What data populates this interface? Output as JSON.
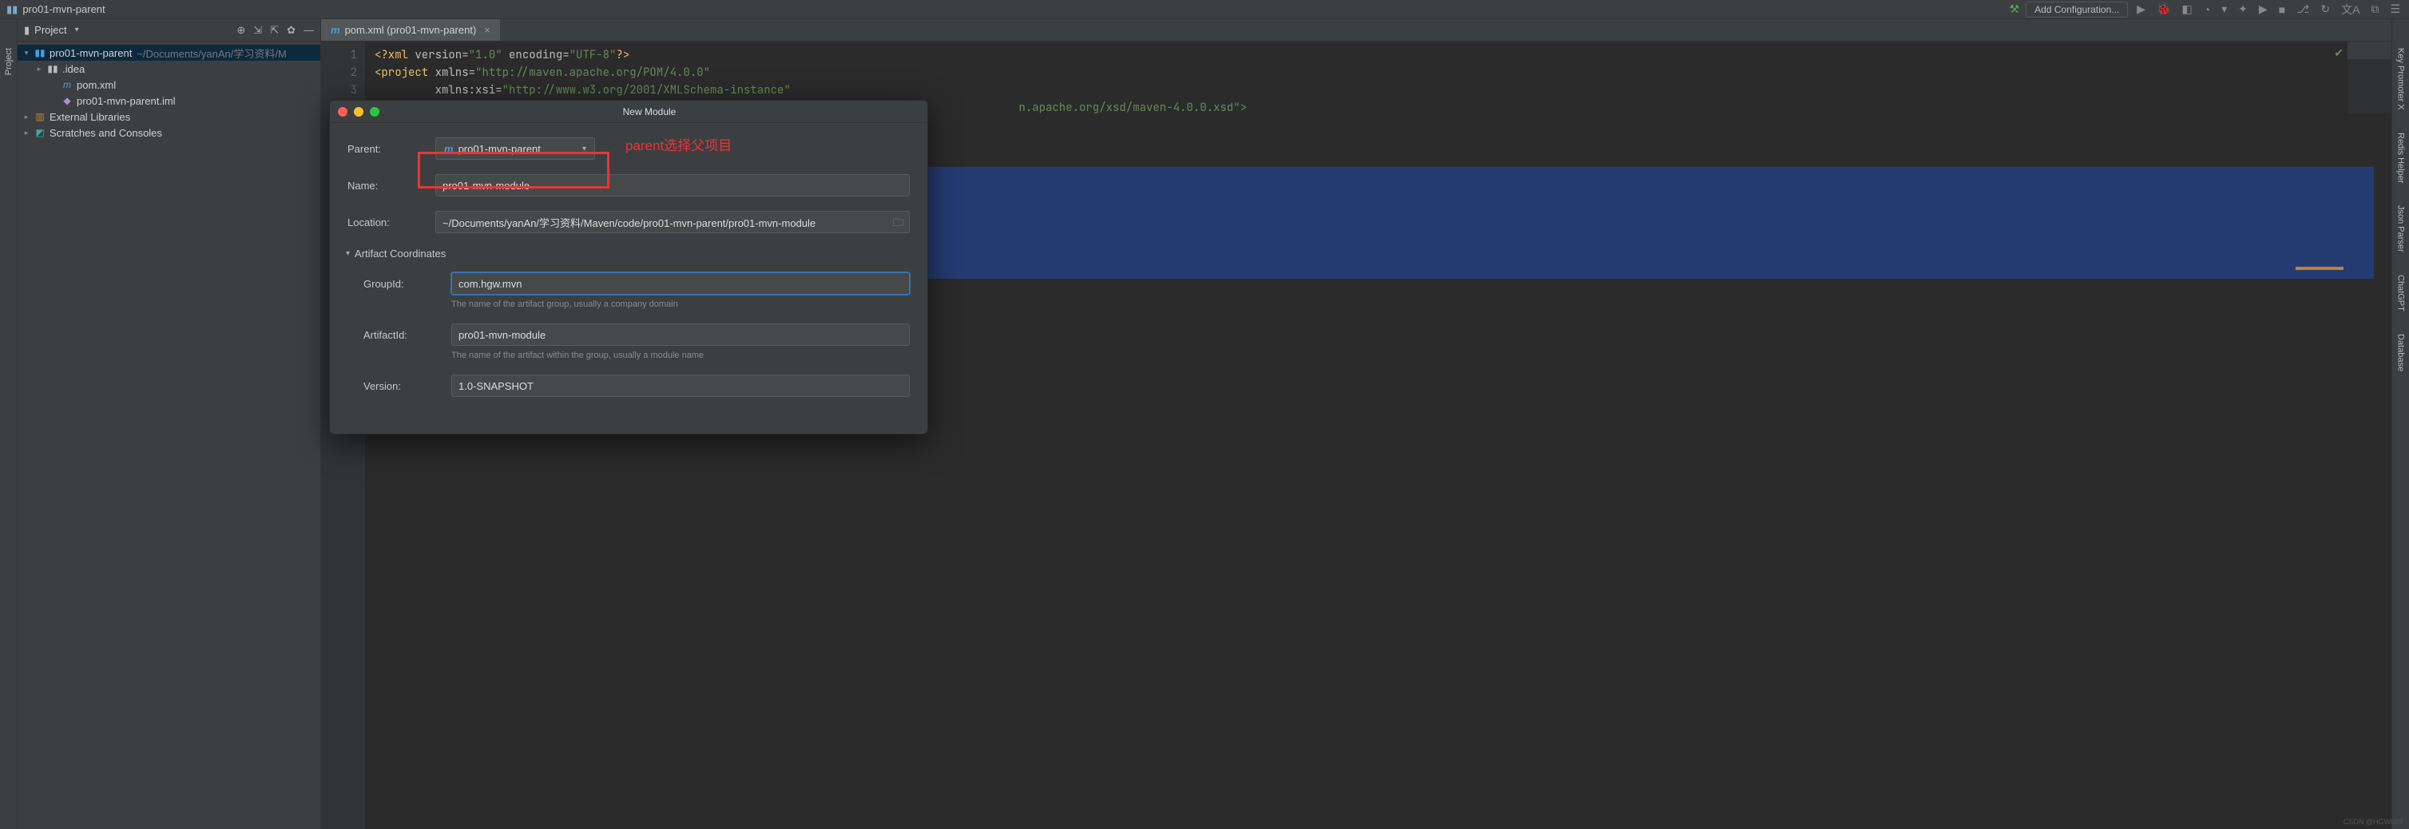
{
  "topbar": {
    "project_name": "pro01-mvn-parent",
    "add_config": "Add Configuration..."
  },
  "left_rail": {
    "project": "Project"
  },
  "project_panel": {
    "title": "Project",
    "root": {
      "name": "pro01-mvn-parent",
      "path": "~/Documents/yanAn/学习资料/M"
    },
    "idea_folder": ".idea",
    "pom_file": "pom.xml",
    "iml_file": "pro01-mvn-parent.iml",
    "ext_libs": "External Libraries",
    "scratches": "Scratches and Consoles"
  },
  "tab": {
    "label": "pom.xml (pro01-mvn-parent)"
  },
  "editor": {
    "lines": [
      "1",
      "2",
      "3"
    ],
    "l1_a": "<?xml ",
    "l1_b": "version",
    "l1_c": "=",
    "l1_d": "\"1.0\"",
    "l1_e": " encoding",
    "l1_f": "=",
    "l1_g": "\"UTF-8\"",
    "l1_h": "?>",
    "l2_a": "<project ",
    "l2_b": "xmlns",
    "l2_c": "=",
    "l2_d": "\"http://maven.apache.org/POM/4.0.0\"",
    "l3_a": "         xmlns:",
    "l3_b": "xsi",
    "l3_c": "=",
    "l3_d": "\"http://www.w3.org/2001/XMLSchema-instance\"",
    "l4_tail": "n.apache.org/xsd/maven-4.0.0.xsd\">"
  },
  "dialog": {
    "title": "New Module",
    "annotation": "parent选择父项目",
    "parent_label": "Parent:",
    "parent_value": "pro01-mvn-parent",
    "name_label": "Name:",
    "name_value": "pro01-mvn-module",
    "location_label": "Location:",
    "location_value": "~/Documents/yanAn/学习资料/Maven/code/pro01-mvn-parent/pro01-mvn-module",
    "section": "Artifact Coordinates",
    "groupid_label": "GroupId:",
    "groupid_value": "com.hgw.mvn",
    "groupid_help": "The name of the artifact group, usually a company domain",
    "artifactid_label": "ArtifactId:",
    "artifactid_value": "pro01-mvn-module",
    "artifactid_help": "The name of the artifact within the group, usually a module name",
    "version_label": "Version:",
    "version_value": "1.0-SNAPSHOT"
  },
  "right_rail": {
    "items": [
      "Key Promoter X",
      "Redis Helper",
      "Json Parser",
      "ChatGPT",
      "Database"
    ]
  },
  "watermark": "CSDN @HGW689"
}
